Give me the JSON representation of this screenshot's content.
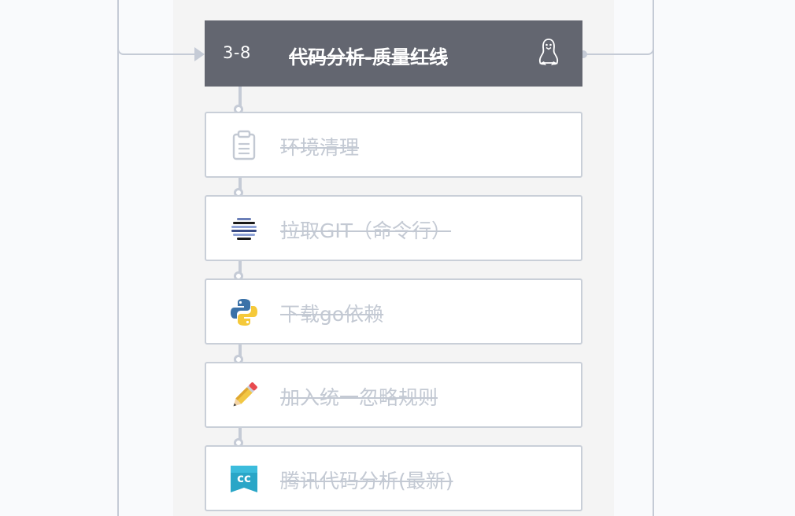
{
  "stage": {
    "number": "3-8",
    "title": "代码分析-质量红线",
    "os_icon": "linux-penguin-icon"
  },
  "tasks": [
    {
      "label": "环境清理",
      "icon": "clipboard-icon"
    },
    {
      "label": "拉取GIT（命令行）",
      "icon": "git-striped-sphere-icon"
    },
    {
      "label": "下载go依赖",
      "icon": "python-icon"
    },
    {
      "label": "加入统一忽略规则",
      "icon": "pencil-icon"
    },
    {
      "label": "腾讯代码分析(最新)",
      "icon": "cc-codecc-icon"
    }
  ],
  "colors": {
    "stage_header_bg": "#636670",
    "disabled_text": "#c3c9d3",
    "connector": "#c5cbd6",
    "column_bg": "#f4f4f4"
  }
}
